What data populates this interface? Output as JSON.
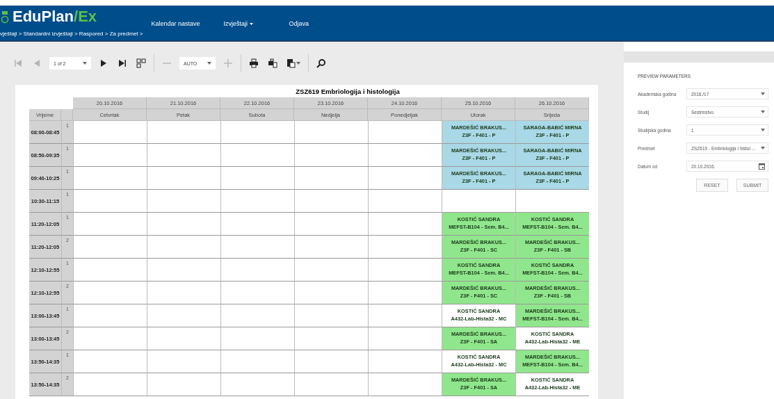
{
  "header": {
    "logo_main": "EduPlan",
    "logo_slash": "/",
    "logo_accent": "Ex",
    "breadcrumb": "vještaji > Standardni izvještaji > Raspored > Za predmet >",
    "nav": [
      {
        "label": "Kalendar nastave",
        "dropdown": false
      },
      {
        "label": "Izvještaji",
        "dropdown": true
      },
      {
        "label": "Odjava",
        "dropdown": false
      }
    ]
  },
  "toolbar": {
    "items": [
      {
        "kind": "first",
        "disabled": true
      },
      {
        "kind": "prev",
        "disabled": true
      },
      {
        "kind": "select",
        "value": "1 of 2"
      },
      {
        "kind": "next",
        "disabled": false
      },
      {
        "kind": "last",
        "disabled": false
      },
      {
        "kind": "pages",
        "disabled": false
      },
      {
        "kind": "separator"
      },
      {
        "kind": "zoom-out",
        "disabled": true
      },
      {
        "kind": "select",
        "value": "AUTO"
      },
      {
        "kind": "zoom-in",
        "disabled": true
      },
      {
        "kind": "separator"
      },
      {
        "kind": "print",
        "disabled": false
      },
      {
        "kind": "print-layout",
        "disabled": false
      },
      {
        "kind": "export",
        "disabled": false
      },
      {
        "kind": "separator"
      },
      {
        "kind": "search",
        "disabled": false
      }
    ]
  },
  "report": {
    "title": "ZSZ619 Embriologija i histologija",
    "time_header": "Vrijeme",
    "columns": [
      {
        "date": "20.10.2016",
        "day": "Cetvrtak"
      },
      {
        "date": "21.10.2016",
        "day": "Petak"
      },
      {
        "date": "22.10.2016",
        "day": "Subota"
      },
      {
        "date": "23.10.2016",
        "day": "Nedjelja"
      },
      {
        "date": "24.10.2016",
        "day": "Ponedjeljak"
      },
      {
        "date": "25.10.2016",
        "day": "Utorak"
      },
      {
        "date": "26.10.2016",
        "day": "Srijeda"
      }
    ],
    "rows": [
      {
        "time": "08:00-08:45",
        "slot": "1",
        "cells": [
          {
            "kind": "empty"
          },
          {
            "kind": "empty"
          },
          {
            "kind": "empty"
          },
          {
            "kind": "empty"
          },
          {
            "kind": "empty"
          },
          {
            "kind": "event",
            "color": "#a9d8e6",
            "teacher": "MARDEŠIĆ BRAKUS...",
            "place": "Z3F - F401 - P"
          },
          {
            "kind": "event",
            "color": "#a9d8e6",
            "teacher": "SARAGA-BABIĆ MIRNA",
            "place": "Z3F - F401 - P"
          }
        ]
      },
      {
        "time": "08:50-09:35",
        "slot": "1",
        "cells": [
          {
            "kind": "empty"
          },
          {
            "kind": "empty"
          },
          {
            "kind": "empty"
          },
          {
            "kind": "empty"
          },
          {
            "kind": "empty"
          },
          {
            "kind": "event",
            "color": "#a9d8e6",
            "teacher": "MARDEŠIĆ BRAKUS...",
            "place": "Z3F - F401 - P"
          },
          {
            "kind": "event",
            "color": "#a9d8e6",
            "teacher": "SARAGA-BABIĆ MIRNA",
            "place": "Z3F - F401 - P"
          }
        ]
      },
      {
        "time": "09:40-10:25",
        "slot": "1",
        "cells": [
          {
            "kind": "empty"
          },
          {
            "kind": "empty"
          },
          {
            "kind": "empty"
          },
          {
            "kind": "empty"
          },
          {
            "kind": "empty"
          },
          {
            "kind": "event",
            "color": "#a9d8e6",
            "teacher": "MARDEŠIĆ BRAKUS...",
            "place": "Z3F - F401 - P"
          },
          {
            "kind": "event",
            "color": "#a9d8e6",
            "teacher": "SARAGA-BABIĆ MIRNA",
            "place": "Z3F - F401 - P"
          }
        ]
      },
      {
        "time": "10:30-11:15",
        "slot": "1",
        "cells": [
          {
            "kind": "empty"
          },
          {
            "kind": "empty"
          },
          {
            "kind": "empty"
          },
          {
            "kind": "empty"
          },
          {
            "kind": "empty"
          },
          {
            "kind": "empty"
          },
          {
            "kind": "empty"
          }
        ]
      },
      {
        "time": "11:20-12:05",
        "slot": "1",
        "cells": [
          {
            "kind": "empty"
          },
          {
            "kind": "empty"
          },
          {
            "kind": "empty"
          },
          {
            "kind": "empty"
          },
          {
            "kind": "empty"
          },
          {
            "kind": "event",
            "color": "#90e68c",
            "teacher": "KOSTIĆ SANDRA",
            "place": "MEFST-B104 - Sem. B4..."
          },
          {
            "kind": "event",
            "color": "#90e68c",
            "teacher": "KOSTIĆ SANDRA",
            "place": "MEFST-B104 - Sem. B4..."
          }
        ]
      },
      {
        "time": "11:20-12:05",
        "slot": "2",
        "cells": [
          {
            "kind": "empty"
          },
          {
            "kind": "empty"
          },
          {
            "kind": "empty"
          },
          {
            "kind": "empty"
          },
          {
            "kind": "empty"
          },
          {
            "kind": "event",
            "color": "#90e68c",
            "teacher": "MARDEŠIĆ BRAKUS...",
            "place": "Z3F - F401 - SC"
          },
          {
            "kind": "event",
            "color": "#90e68c",
            "teacher": "MARDEŠIĆ BRAKUS...",
            "place": "Z3F - F401 - SB"
          }
        ]
      },
      {
        "time": "12:10-12:55",
        "slot": "1",
        "cells": [
          {
            "kind": "empty"
          },
          {
            "kind": "empty"
          },
          {
            "kind": "empty"
          },
          {
            "kind": "empty"
          },
          {
            "kind": "empty"
          },
          {
            "kind": "event",
            "color": "#90e68c",
            "teacher": "KOSTIĆ SANDRA",
            "place": "MEFST-B104 - Sem. B4..."
          },
          {
            "kind": "event",
            "color": "#90e68c",
            "teacher": "KOSTIĆ SANDRA",
            "place": "MEFST-B104 - Sem. B4..."
          }
        ]
      },
      {
        "time": "12:10-12:55",
        "slot": "2",
        "cells": [
          {
            "kind": "empty"
          },
          {
            "kind": "empty"
          },
          {
            "kind": "empty"
          },
          {
            "kind": "empty"
          },
          {
            "kind": "empty"
          },
          {
            "kind": "event",
            "color": "#90e68c",
            "teacher": "MARDEŠIĆ BRAKUS...",
            "place": "Z3F - F401 - SC"
          },
          {
            "kind": "event",
            "color": "#90e68c",
            "teacher": "MARDEŠIĆ BRAKUS...",
            "place": "Z3F - F401 - SB"
          }
        ]
      },
      {
        "time": "13:00-13:45",
        "slot": "1",
        "cells": [
          {
            "kind": "empty"
          },
          {
            "kind": "empty"
          },
          {
            "kind": "empty"
          },
          {
            "kind": "empty"
          },
          {
            "kind": "empty"
          },
          {
            "kind": "event",
            "color": "#ffffff",
            "teacher": "KOSTIĆ SANDRA",
            "place": "A432-Lab-Hista32 - MC"
          },
          {
            "kind": "event",
            "color": "#90e68c",
            "teacher": "MARDEŠIĆ BRAKUS...",
            "place": "MEFST-B104 - Sem. B4..."
          }
        ]
      },
      {
        "time": "13:00-13:45",
        "slot": "2",
        "cells": [
          {
            "kind": "empty"
          },
          {
            "kind": "empty"
          },
          {
            "kind": "empty"
          },
          {
            "kind": "empty"
          },
          {
            "kind": "empty"
          },
          {
            "kind": "event",
            "color": "#90e68c",
            "teacher": "MARDEŠIĆ BRAKUS...",
            "place": "Z3F - F401 - SA"
          },
          {
            "kind": "event",
            "color": "#ffffff",
            "teacher": "KOSTIĆ SANDRA",
            "place": "A432-Lab-Hista32 - ME"
          }
        ]
      },
      {
        "time": "13:50-14:35",
        "slot": "1",
        "cells": [
          {
            "kind": "empty"
          },
          {
            "kind": "empty"
          },
          {
            "kind": "empty"
          },
          {
            "kind": "empty"
          },
          {
            "kind": "empty"
          },
          {
            "kind": "event",
            "color": "#ffffff",
            "teacher": "KOSTIĆ SANDRA",
            "place": "A432-Lab-Hista32 - MC"
          },
          {
            "kind": "event",
            "color": "#90e68c",
            "teacher": "MARDEŠIĆ BRAKUS...",
            "place": "MEFST-B104 - Sem. B4..."
          }
        ]
      },
      {
        "time": "13:50-14:35",
        "slot": "2",
        "cells": [
          {
            "kind": "empty"
          },
          {
            "kind": "empty"
          },
          {
            "kind": "empty"
          },
          {
            "kind": "empty"
          },
          {
            "kind": "empty"
          },
          {
            "kind": "event",
            "color": "#90e68c",
            "teacher": "MARDEŠIĆ BRAKUS...",
            "place": "Z3F - F401 - SA"
          },
          {
            "kind": "event",
            "color": "#ffffff",
            "teacher": "KOSTIĆ SANDRA",
            "place": "A432-Lab-Hista32 - ME"
          }
        ]
      }
    ]
  },
  "parameters": {
    "title": "PREVIEW PARAMETERS",
    "fields": [
      {
        "kind": "select",
        "label": "Akademska godina",
        "value": "2016./17"
      },
      {
        "kind": "select",
        "label": "Studij",
        "value": "Sestrinstvo"
      },
      {
        "kind": "select",
        "label": "Studijska godina",
        "value": "1"
      },
      {
        "kind": "select",
        "label": "Predmet",
        "value": "ZSZ619 - Embriologija i histol ..."
      },
      {
        "kind": "date",
        "label": "Datum od",
        "value": "20.10.2016."
      }
    ],
    "buttons": [
      "RESET",
      "SUBMIT"
    ]
  }
}
